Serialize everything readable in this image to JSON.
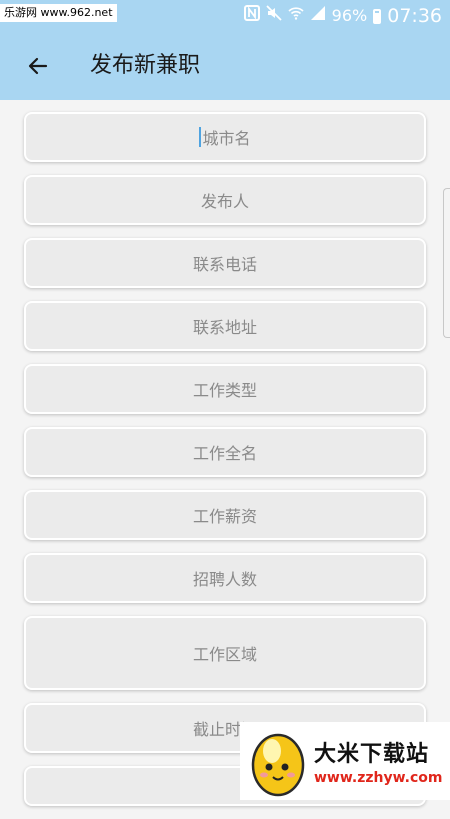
{
  "status_bar": {
    "watermark": "乐游网 www.962.net",
    "nfc_icon": "nfc-icon",
    "mute_icon": "mute-icon",
    "wifi_icon": "wifi-icon",
    "signal_icon": "signal-icon",
    "battery_percent": "96%",
    "time": "07:36"
  },
  "toolbar": {
    "back_icon": "arrow-left-icon",
    "title": "发布新兼职"
  },
  "form": {
    "fields": [
      {
        "placeholder": "城市名",
        "focused": true
      },
      {
        "placeholder": "发布人"
      },
      {
        "placeholder": "联系电话"
      },
      {
        "placeholder": "联系地址"
      },
      {
        "placeholder": "工作类型"
      },
      {
        "placeholder": "工作全名"
      },
      {
        "placeholder": "工作薪资"
      },
      {
        "placeholder": "招聘人数"
      },
      {
        "placeholder": "工作区域"
      },
      {
        "placeholder": "截止时间"
      }
    ]
  },
  "watermark_badge": {
    "title": "大米下载站",
    "url": "www.zzhyw.com"
  },
  "colors": {
    "header_bg": "#a9d6f2",
    "page_bg": "#f4f4f4",
    "field_bg": "#ebebeb",
    "placeholder": "#8a8a8a",
    "cursor": "#4fa3e0"
  }
}
